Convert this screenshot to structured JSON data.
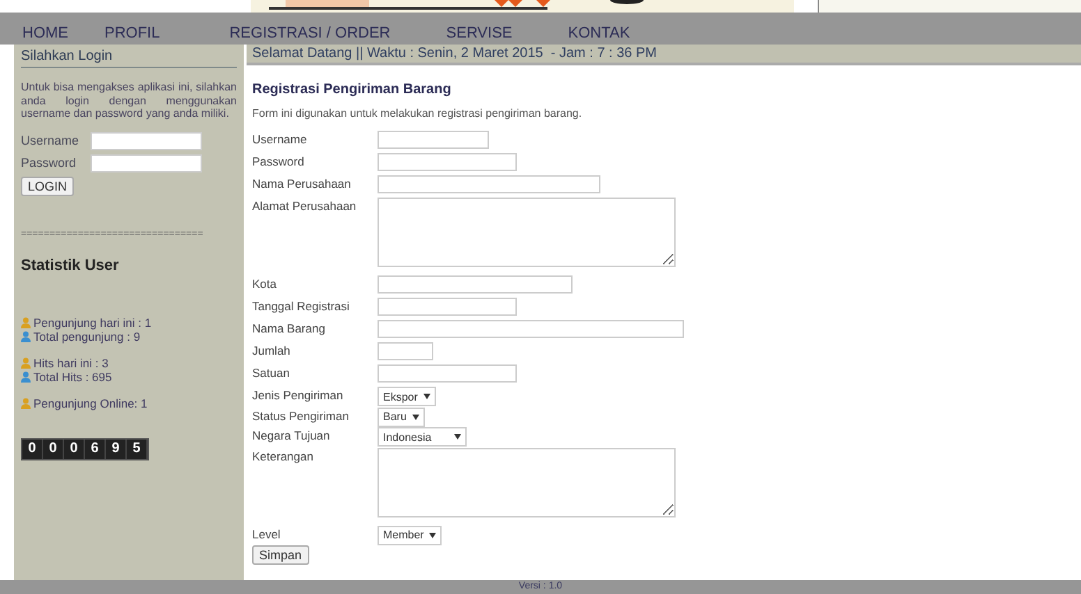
{
  "nav": [
    {
      "label": "HOME"
    },
    {
      "label": "PROFIL"
    },
    {
      "label": "REGISTRASI / ORDER"
    },
    {
      "label": "SERVISE"
    },
    {
      "label": "KONTAK"
    }
  ],
  "sidebar": {
    "login_title": "Silahkan Login",
    "intro": "Untuk bisa mengakses aplikasi ini, silahkan anda login dengan menggunakan username dan password yang anda miliki.",
    "fields": [
      {
        "label": "Username"
      },
      {
        "label": "Password"
      }
    ],
    "login_button": "LOGIN",
    "separator": "================================",
    "stats_title": "Statistik User",
    "stats": [
      [
        {
          "text": "Pengunjung hari ini : 1",
          "color": "#d9a020"
        },
        {
          "text": "Total pengunjung : 9",
          "color": "#3a8fd0"
        }
      ],
      [
        {
          "text": "Hits hari ini : 3",
          "color": "#d9a020"
        },
        {
          "text": "Total Hits : 695",
          "color": "#3a8fd0"
        }
      ],
      [
        {
          "text": "Pengunjung Online: 1",
          "color": "#d9a020"
        }
      ]
    ],
    "counter": [
      "0",
      "0",
      "0",
      "6",
      "9",
      "5"
    ]
  },
  "welcome": "Selamat Datang || Waktu : Senin, 2 Maret 2015  - Jam : 7 : 36 PM",
  "form": {
    "title": "Registrasi Pengiriman Barang",
    "description": "Form ini digunakan untuk melakukan registrasi pengiriman barang.",
    "fields": [
      {
        "label": "Username",
        "kind": "text"
      },
      {
        "label": "Password",
        "kind": "text"
      },
      {
        "label": "Nama Perusahaan",
        "kind": "text"
      },
      {
        "label": "Alamat Perusahaan",
        "kind": "textarea"
      },
      {
        "label": "Kota",
        "kind": "text"
      },
      {
        "label": "Tanggal Registrasi",
        "kind": "text"
      },
      {
        "label": "Nama Barang",
        "kind": "text"
      },
      {
        "label": "Jumlah",
        "kind": "text"
      },
      {
        "label": "Satuan",
        "kind": "text"
      },
      {
        "label": "Jenis Pengiriman",
        "kind": "select",
        "value": "Ekspor"
      },
      {
        "label": "Status Pengiriman",
        "kind": "select",
        "value": "Baru"
      },
      {
        "label": "Negara Tujuan",
        "kind": "select",
        "value": "Indonesia"
      },
      {
        "label": "Keterangan",
        "kind": "textarea"
      },
      {
        "label": "Level",
        "kind": "select",
        "value": "Member"
      }
    ],
    "submit": "Simpan"
  },
  "footer": "Versi : 1.0"
}
